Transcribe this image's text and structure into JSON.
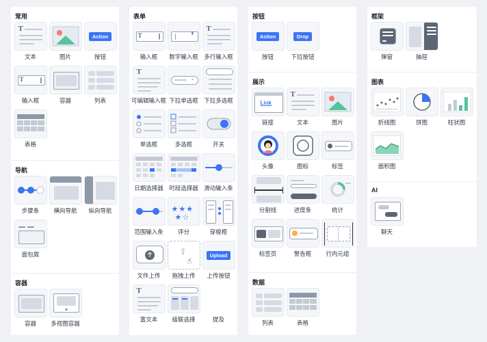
{
  "col1": {
    "sections": [
      {
        "title": "常用",
        "items": [
          "文本",
          "图片",
          "按钮",
          "输入框",
          "容器",
          "列表",
          "表格"
        ]
      },
      {
        "title": "导航",
        "items": [
          "步骤条",
          "横向导航",
          "纵向导航",
          "面包屑"
        ]
      },
      {
        "title": "容器",
        "items": [
          "容器",
          "多视图容器"
        ]
      }
    ]
  },
  "col2": {
    "sections": [
      {
        "title": "表单",
        "items": [
          "输入框",
          "数字输入框",
          "多行输入框",
          "可编辑输入框",
          "下拉单选框",
          "下拉多选框",
          "单选框",
          "多选框",
          "开关",
          "日期选择器",
          "时段选择器",
          "滑动输入条",
          "范围输入条",
          "评分",
          "穿梭框",
          "文件上传",
          "拖拽上传",
          "上传按钮",
          "富文本",
          "级联选择",
          "提及"
        ]
      }
    ]
  },
  "col3": {
    "sections": [
      {
        "title": "按钮",
        "items": [
          "按钮",
          "下拉按钮"
        ]
      },
      {
        "title": "展示",
        "items": [
          "链接",
          "文本",
          "图片",
          "头像",
          "图标",
          "标签",
          "分割线",
          "进度条",
          "统计",
          "标签页",
          "警告框",
          "行内元组"
        ]
      },
      {
        "title": "数据",
        "items": [
          "列表",
          "表格"
        ]
      }
    ]
  },
  "col4": {
    "sections": [
      {
        "title": "框架",
        "items": [
          "弹窗",
          "抽屉"
        ]
      },
      {
        "title": "图表",
        "items": [
          "折线图",
          "饼图",
          "柱状图",
          "面积图"
        ]
      },
      {
        "title": "AI",
        "items": [
          "聊天"
        ]
      }
    ]
  },
  "glyph_text": {
    "action": "Action",
    "drop": "Drop",
    "link": "Link",
    "upload": "Upload",
    "t": "T"
  },
  "colors": {
    "accent": "#3c74f5",
    "green": "#58c29a",
    "red": "#f07d6a"
  }
}
